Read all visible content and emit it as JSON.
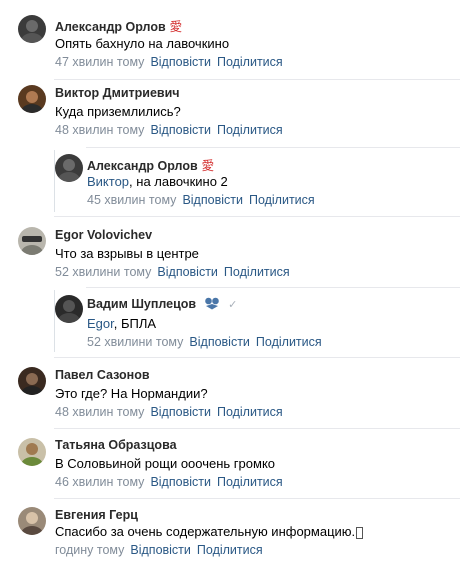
{
  "comments": [
    {
      "name": "Александр Орлов",
      "name_suffix": "愛",
      "text": "Опять бахнуло на лавочкино",
      "time": "47 хвилин тому",
      "reply": "Відповісти",
      "share": "Поділитися"
    },
    {
      "name": "Виктор Дмитриевич",
      "text": "Куда приземлились?",
      "time": "48 хвилин тому",
      "reply": "Відповісти",
      "share": "Поділитися"
    },
    {
      "name": "Александр Орлов",
      "name_suffix": "愛",
      "mention": "Виктор",
      "text": ", на лавочкино 2",
      "time": "45 хвилин тому",
      "reply": "Відповісти",
      "share": "Поділитися"
    },
    {
      "name": "Egor Volovichev",
      "text": "Что за взрывы в центре",
      "time": "52 хвилини тому",
      "reply": "Відповісти",
      "share": "Поділитися"
    },
    {
      "name": "Вадим Шуплецов",
      "mention": "Egor",
      "text": ", БПЛА",
      "time": "52 хвилини тому",
      "reply": "Відповісти",
      "share": "Поділитися"
    },
    {
      "name": "Павел Сазонов",
      "text": "Это где? На Нормандии?",
      "time": "48 хвилин тому",
      "reply": "Відповісти",
      "share": "Поділитися"
    },
    {
      "name": "Татьяна Образцова",
      "text": "В Соловьиной рощи ооочень громко",
      "time": "46 хвилин тому",
      "reply": "Відповісти",
      "share": "Поділитися"
    },
    {
      "name": "Евгения Герц",
      "text": "Спасибо за очень содержательную информацию.",
      "time": "годину тому",
      "reply": "Відповісти",
      "share": "Поділитися"
    }
  ],
  "colors": {
    "link": "#2a5885",
    "meta": "#818c99",
    "name": "#2a2a2a",
    "separator": "#e7e8ec"
  }
}
